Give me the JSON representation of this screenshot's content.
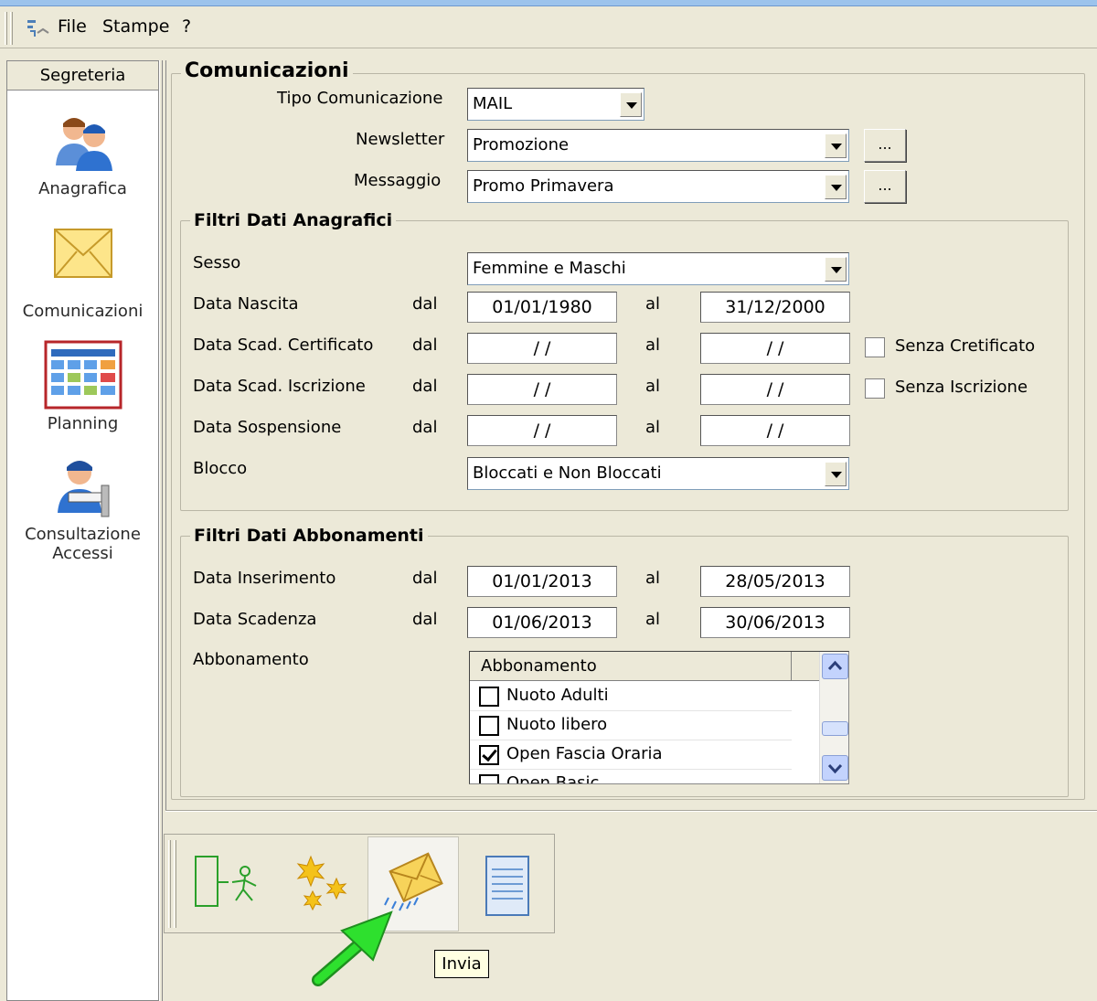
{
  "menu": {
    "file": "File",
    "stampe": "Stampe",
    "help": "?"
  },
  "sidebar": {
    "header": "Segreteria",
    "items": [
      {
        "label": "Anagrafica",
        "icon": "users-icon"
      },
      {
        "label": "Comunicazioni",
        "icon": "envelope-icon"
      },
      {
        "label": "Planning",
        "icon": "calendar-grid-icon"
      },
      {
        "label": "Consultazione Accessi",
        "icon": "access-user-icon"
      }
    ]
  },
  "comunicazioni": {
    "title": "Comunicazioni",
    "tipo_label": "Tipo Comunicazione",
    "tipo_value": "MAIL",
    "newsletter_label": "Newsletter",
    "newsletter_value": "Promozione",
    "messaggio_label": "Messaggio",
    "messaggio_value": "Promo Primavera",
    "dots": "..."
  },
  "anagrafici": {
    "title": "Filtri Dati Anagrafici",
    "sesso_label": "Sesso",
    "sesso_value": "Femmine e Maschi",
    "nascita_label": "Data Nascita",
    "nascita_from": "01/01/1980",
    "nascita_to": "31/12/2000",
    "certificato_label": "Data Scad. Certificato",
    "certificato_from": "/ /",
    "certificato_to": "/ /",
    "senza_certificato": "Senza Cretificato",
    "iscrizione_label": "Data Scad. Iscrizione",
    "iscrizione_from": "/ /",
    "iscrizione_to": "/ /",
    "senza_iscrizione": "Senza Iscrizione",
    "sospensione_label": "Data Sospensione",
    "sospensione_from": "/ /",
    "sospensione_to": "/ /",
    "blocco_label": "Blocco",
    "blocco_value": "Bloccati e Non Bloccati",
    "dal": "dal",
    "al": "al"
  },
  "abbonamenti": {
    "title": "Filtri Dati Abbonamenti",
    "inserimento_label": "Data Inserimento",
    "inserimento_from": "01/01/2013",
    "inserimento_to": "28/05/2013",
    "scadenza_label": "Data Scadenza",
    "scadenza_from": "01/06/2013",
    "scadenza_to": "30/06/2013",
    "abbonamento_label": "Abbonamento",
    "list_header": "Abbonamento",
    "rows": [
      {
        "label": "Nuoto Adulti",
        "checked": false
      },
      {
        "label": "Nuoto libero",
        "checked": false
      },
      {
        "label": "Open Fascia Oraria",
        "checked": true
      },
      {
        "label": "Open Basic",
        "checked": false
      }
    ]
  },
  "toolbar": {
    "buttons": [
      "exit-icon",
      "new-icon",
      "send-mail-icon",
      "document-icon"
    ],
    "tooltip": "Invia"
  },
  "colors": {
    "background": "#ece9d8",
    "titlebar": "#9cc3ec",
    "arrow": "#2ec82e",
    "tooltip": "#ffffe1"
  }
}
